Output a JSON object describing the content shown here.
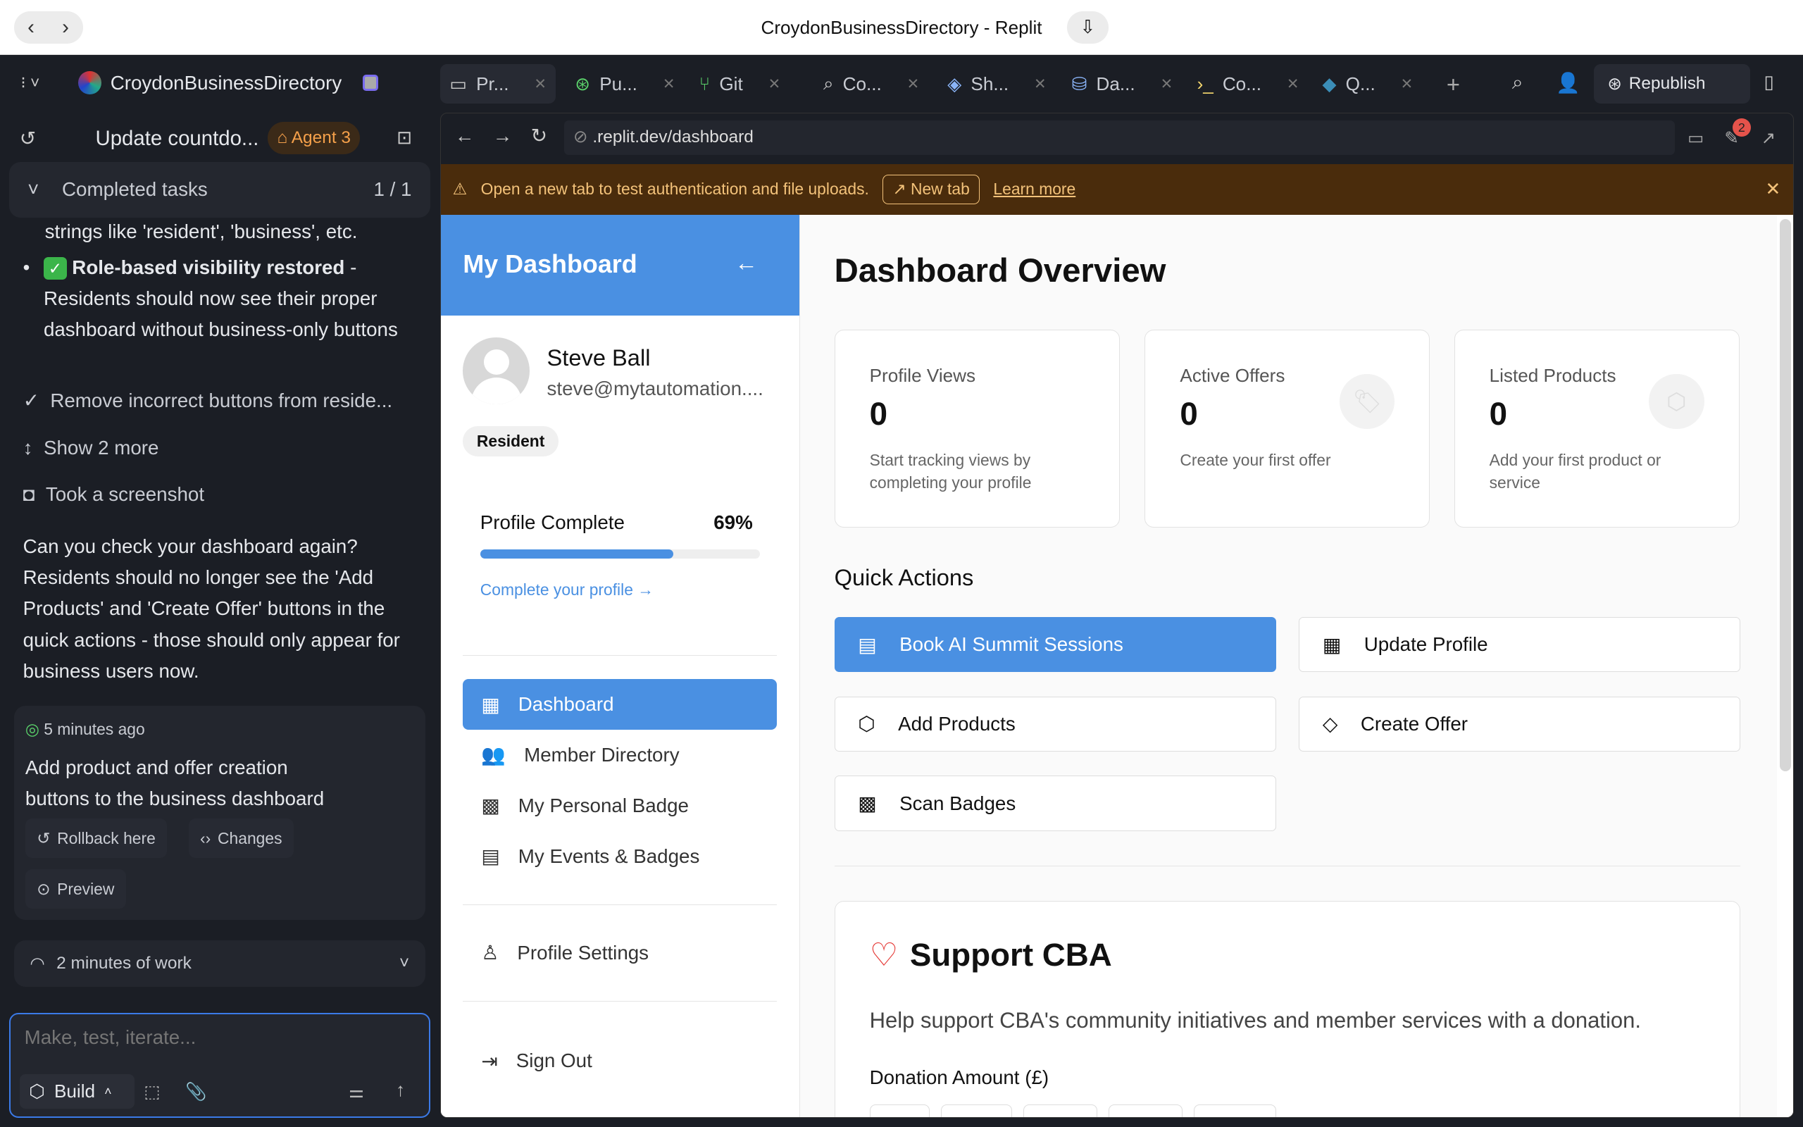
{
  "window": {
    "title": "CroydonBusinessDirectory - Replit"
  },
  "toolbar": {
    "project": "CroydonBusinessDirectory",
    "tabs": [
      {
        "label": "Pr...",
        "icon": "monitor-icon"
      },
      {
        "label": "Pu...",
        "icon": "publish-icon"
      },
      {
        "label": "Git",
        "icon": "git-icon"
      },
      {
        "label": "Co...",
        "icon": "search-icon"
      },
      {
        "label": "Sh...",
        "icon": "shell-icon"
      },
      {
        "label": "Da...",
        "icon": "database-icon"
      },
      {
        "label": "Co...",
        "icon": "console-icon"
      },
      {
        "label": "Q...",
        "icon": "python-icon"
      }
    ],
    "republish": "Republish"
  },
  "agent": {
    "chat_title": "Update countdo...",
    "agent_badge": "Agent 3",
    "completed_tasks": "Completed tasks",
    "completed_count": "1 / 1",
    "partial_line": "strings like 'resident', 'business', etc.",
    "bullet_bold": "Role-based visibility restored",
    "bullet_rest": " - Residents should now see their proper dashboard without business-only buttons",
    "step1": "Remove incorrect buttons from reside...",
    "show_more": "Show 2 more",
    "screenshot": "Took a screenshot",
    "message": "Can you check your dashboard again? Residents should no longer see the 'Add Products' and 'Create Offer' buttons in the quick actions - those should only appear for business users now.",
    "checkpoint_time": "5 minutes ago",
    "checkpoint_text": "Add product and offer creation buttons to the business dashboard",
    "rollback": "Rollback here",
    "changes": "Changes",
    "preview": "Preview",
    "work": "2 minutes of work",
    "input_placeholder": "Make, test, iterate...",
    "mode": "Build"
  },
  "browser": {
    "url": ".replit.dev/dashboard",
    "badge_count": "2",
    "banner": "Open a new tab to test authentication and file uploads.",
    "new_tab": "New tab",
    "learn_more": "Learn more"
  },
  "app": {
    "sidebar_title": "My Dashboard",
    "user_name": "Steve Ball",
    "user_email": "steve@mytautomation....",
    "role": "Resident",
    "profile_complete_label": "Profile Complete",
    "profile_complete": 69,
    "profile_complete_text": "69%",
    "complete_link": "Complete your profile →",
    "nav": [
      "Dashboard",
      "Member Directory",
      "My Personal Badge",
      "My Events & Badges"
    ],
    "settings": "Profile Settings",
    "sign_out": "Sign Out",
    "title": "Dashboard Overview",
    "stats": [
      {
        "label": "Profile Views",
        "value": "0",
        "desc": "Start tracking views by completing your profile"
      },
      {
        "label": "Active Offers",
        "value": "0",
        "desc": "Create your first offer"
      },
      {
        "label": "Listed Products",
        "value": "0",
        "desc": "Add your first product or service"
      }
    ],
    "quick_actions_title": "Quick Actions",
    "quick_actions": [
      "Book AI Summit Sessions",
      "Update Profile",
      "Add Products",
      "Create Offer",
      "Scan Badges"
    ],
    "support_title": "Support CBA",
    "support_desc": "Help support CBA's community initiatives and member services with a donation.",
    "donation_label": "Donation Amount (£)"
  },
  "colors": {
    "accent": "#4a90e2",
    "banner": "#4a2c0c",
    "agent": "#f5a04a"
  }
}
